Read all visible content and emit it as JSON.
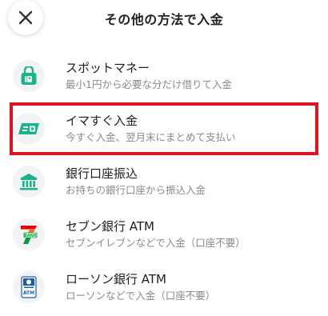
{
  "header": {
    "title": "その他の方法で入金",
    "close_icon": "close-icon"
  },
  "methods": [
    {
      "title": "スポットマネー",
      "description": "最小1円から必要な分だけ借りて入金",
      "icon": "locker-icon",
      "selected": false
    },
    {
      "title": "イマすぐ入金",
      "description": "今すぐ入金、翌月末にまとめて支払い",
      "icon": "instant-card-icon",
      "selected": true
    },
    {
      "title": "銀行口座振込",
      "description": "お持ちの銀行口座から振込入金",
      "icon": "bank-icon",
      "selected": false
    },
    {
      "title": "セブン銀行 ATM",
      "description": "セブンイレブンなどで入金（口座不要）",
      "icon": "seven-bank-logo",
      "selected": false
    },
    {
      "title": "ローソン銀行 ATM",
      "description": "ローソンなどで入金（口座不要）",
      "icon": "lawson-bank-logo",
      "selected": false
    }
  ],
  "logos": {
    "seven_bank_text": "BANK",
    "lawson_bank_text": "ATM"
  },
  "colors": {
    "accent_green": "#1bb48a",
    "highlight_red": "#e0141e",
    "seven_orange": "#f36f21",
    "seven_green": "#00a040",
    "seven_red": "#e60012",
    "lawson_blue": "#1a5cb0"
  }
}
